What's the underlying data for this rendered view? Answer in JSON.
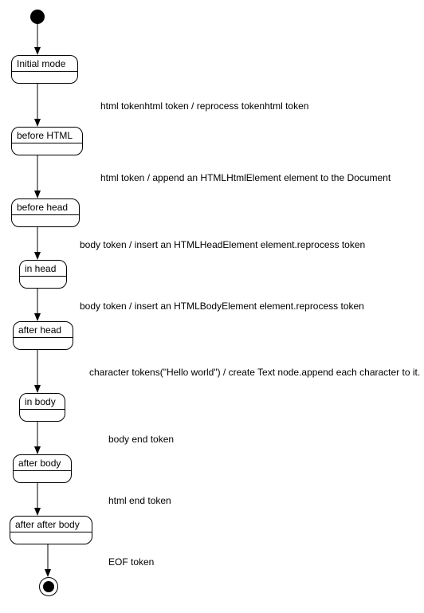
{
  "chart_data": {
    "type": "state-diagram",
    "title": "",
    "states": [
      {
        "id": "start",
        "kind": "initial",
        "label": ""
      },
      {
        "id": "initial_mode",
        "kind": "state",
        "label": "Initial mode"
      },
      {
        "id": "before_html",
        "kind": "state",
        "label": "before HTML"
      },
      {
        "id": "before_head",
        "kind": "state",
        "label": "before head"
      },
      {
        "id": "in_head",
        "kind": "state",
        "label": "in head"
      },
      {
        "id": "after_head",
        "kind": "state",
        "label": "after head"
      },
      {
        "id": "in_body",
        "kind": "state",
        "label": "in body"
      },
      {
        "id": "after_body",
        "kind": "state",
        "label": "after body"
      },
      {
        "id": "after_after_body",
        "kind": "state",
        "label": "after after body"
      },
      {
        "id": "end",
        "kind": "final",
        "label": ""
      }
    ],
    "transitions": [
      {
        "from": "start",
        "to": "initial_mode",
        "label": ""
      },
      {
        "from": "initial_mode",
        "to": "before_html",
        "label": "html tokenhtml token / reprocess tokenhtml token"
      },
      {
        "from": "before_html",
        "to": "before_head",
        "label": "html token / append an HTMLHtmlElement element to the Document"
      },
      {
        "from": "before_head",
        "to": "in_head",
        "label": "body token / insert an HTMLHeadElement element.reprocess token"
      },
      {
        "from": "in_head",
        "to": "after_head",
        "label": "body token / insert an HTMLBodyElement element.reprocess token"
      },
      {
        "from": "after_head",
        "to": "in_body",
        "label": "character tokens(\"Hello world\") / create Text node.append each character to it."
      },
      {
        "from": "in_body",
        "to": "after_body",
        "label": "body end token"
      },
      {
        "from": "after_body",
        "to": "after_after_body",
        "label": "html end token"
      },
      {
        "from": "after_after_body",
        "to": "end",
        "label": "EOF token"
      }
    ]
  }
}
